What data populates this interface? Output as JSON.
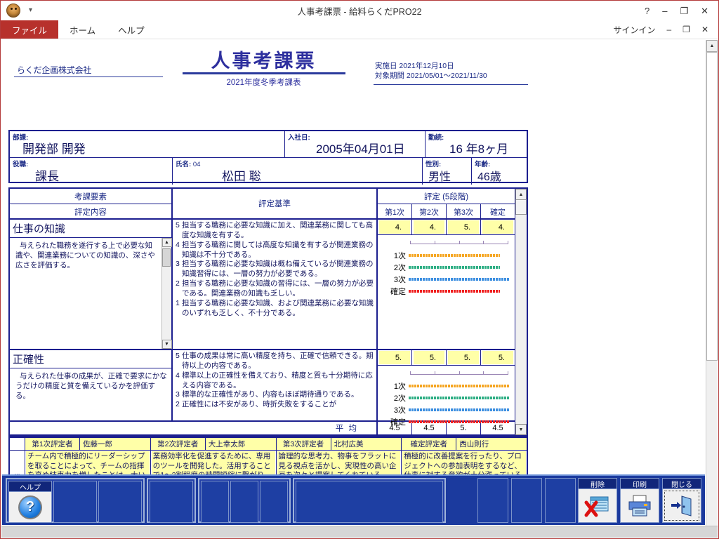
{
  "window": {
    "title": "人事考課票 - 給料らくだPRO22",
    "logo_icon": "camel-logo-icon",
    "quick_access_caret": "▾",
    "help_icon": "?",
    "minimize_icon": "–",
    "restore_icon": "❐",
    "close_icon": "✕"
  },
  "ribbon": {
    "tabs": [
      {
        "label": "ファイル",
        "active": true
      },
      {
        "label": "ホーム",
        "active": false
      },
      {
        "label": "ヘルプ",
        "active": false
      }
    ],
    "signin_label": "サインイン",
    "minimize_icon": "–",
    "restore_icon": "❐",
    "close_icon": "✕"
  },
  "document": {
    "company": "らくだ企画株式会社",
    "title": "人事考課票",
    "subtitle": "2021年度冬季考課表",
    "implementation_label": "実施日",
    "implementation_date": "2021年12月10日",
    "period_label": "対象期間",
    "period_value": "2021/05/01～2021/11/30"
  },
  "employee": {
    "dept_label": "部課:",
    "dept_value": "開発部 開発",
    "hire_label": "入社日:",
    "hire_value": "2005年04月01日",
    "tenure_label": "勤続:",
    "tenure_value": "16 年8ヶ月",
    "position_label": "役職:",
    "position_value": "課長",
    "name_label": "氏名:",
    "name_code": "04",
    "name_value": "松田 聡",
    "gender_label": "性別:",
    "gender_value": "男性",
    "age_label": "年齢:",
    "age_value": "46歳"
  },
  "eval_table": {
    "header": {
      "factor": "考課要素",
      "content": "評定内容",
      "criteria": "評定基準",
      "rating_group": "評定 (5段階)",
      "cols": [
        "第1次",
        "第2次",
        "第3次",
        "確定"
      ]
    },
    "graph_series_labels": [
      "1次",
      "2次",
      "3次",
      "確定"
    ],
    "graph_colors": {
      "first": "#f5a623",
      "second": "#2eae84",
      "third": "#3d8fe0",
      "final": "#f02020"
    },
    "items": [
      {
        "name": "仕事の知識",
        "description": "与えられた職務を遂行する上で必要な知識や、関連業務についての知識の、深さや広さを評価する。",
        "criteria": [
          {
            "n": "5",
            "t": "担当する職務に必要な知識に加え、関連業務に関しても高度な知識を有する。"
          },
          {
            "n": "4",
            "t": "担当する職務に関しては高度な知識を有するが関連業務の知識は不十分である。"
          },
          {
            "n": "3",
            "t": "担当する職務に必要な知識は概ね備えているが関連業務の知識習得には、一層の努力が必要である。"
          },
          {
            "n": "2",
            "t": "担当する職務に必要な知識の習得には、一層の努力が必要である。関連業務の知識も乏しい。"
          },
          {
            "n": "1",
            "t": "担当する職務に必要な知識、および関連業務に必要な知識のいずれも乏しく、不十分である。"
          }
        ],
        "scores": [
          "4.",
          "4.",
          "5.",
          "4."
        ],
        "graph_values": [
          4,
          4,
          5,
          4
        ]
      },
      {
        "name": "正確性",
        "description": "与えられた仕事の成果が、正確で要求にかなうだけの精度と質を備えているかを評価する。",
        "criteria": [
          {
            "n": "5",
            "t": "仕事の成果は常に高い精度を持ち、正確で信頼できる。期待以上の内容である。"
          },
          {
            "n": "4",
            "t": "標準以上の正確性を備えており、精度と質も十分期待に応える内容である。"
          },
          {
            "n": "3",
            "t": "標準的な正確性があり、内容もほぼ期待通りである。"
          },
          {
            "n": "2",
            "t": "正確性には不安があり、時折失敗をすることが"
          }
        ],
        "scores": [
          "5.",
          "5.",
          "5.",
          "5."
        ],
        "graph_values": [
          5,
          5,
          5,
          5
        ]
      }
    ],
    "average": {
      "label": "平 均",
      "values": [
        "4.5",
        "4.5",
        "5.",
        "4.5"
      ]
    }
  },
  "remarks": {
    "vlabel": "備考",
    "columns": [
      {
        "title": "第1次評定者",
        "name": "佐藤一郎",
        "text": "チーム内で積極的にリーダーシップを取ることによって、チームの指揮を高め結束力を増したことは、大いに評価に値する。"
      },
      {
        "title": "第2次評定者",
        "name": "大上幸太郎",
        "text": "業務効率化を促進するために、専用のツールを開発した。活用することで1～2割程度の時間短縮に繋がり、チームメンバーにも喜ばれた。"
      },
      {
        "title": "第3次評定者",
        "name": "北村広美",
        "text": "論理的な思考力、物事をフラットに見る視点を活かし、実現性の高い企画を次々と提案してくれている。"
      },
      {
        "title": "確定評定者",
        "name": "西山則行",
        "text": "積極的に改善提案を行ったり、プロジェクトへの参加表明をするなど、仕事に対する意欲が十分漲っているように感じる。積極性は何よりの武器になるため、その強みを活かして今後とも活躍してほしい。"
      }
    ]
  },
  "toolbar": {
    "help_label": "ヘルプ",
    "help_icon": "question-mark-icon",
    "delete_label": "削除",
    "delete_icon": "delete-record-icon",
    "print_label": "印刷",
    "print_icon": "printer-icon",
    "close_label": "閉じる",
    "close_icon": "exit-door-icon"
  },
  "scrollbars": {
    "up_arrow": "▲",
    "down_arrow": "▼"
  }
}
